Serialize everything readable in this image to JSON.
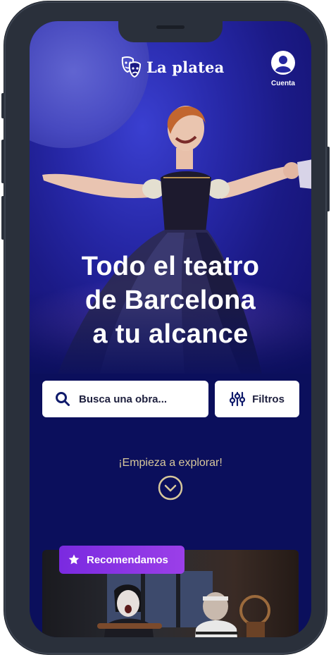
{
  "header": {
    "brand": "La platea",
    "account_label": "Cuenta"
  },
  "hero": {
    "headline_line1": "Todo el teatro",
    "headline_line2": "de Barcelona",
    "headline_line3": "a tu alcance"
  },
  "search": {
    "placeholder": "Busca una obra...",
    "filters_label": "Filtros"
  },
  "explore": {
    "label": "¡Empieza a explorar!"
  },
  "featured": {
    "badge_label": "Recomendamos"
  },
  "colors": {
    "background": "#0b0f5c",
    "accent": "#8a35e6",
    "explore_text": "#d7c79b",
    "frame": "#2a303b"
  }
}
